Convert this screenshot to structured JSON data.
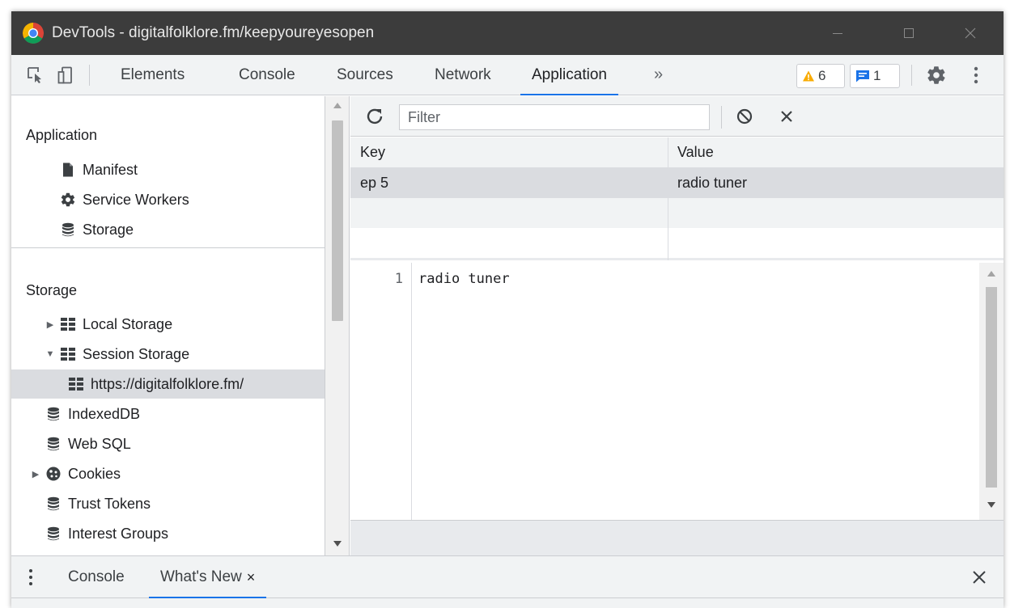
{
  "window": {
    "title": "DevTools - digitalfolklore.fm/keepyoureyesopen"
  },
  "toolbar": {
    "tabs": [
      {
        "label": "Elements"
      },
      {
        "label": "Console"
      },
      {
        "label": "Sources"
      },
      {
        "label": "Network"
      },
      {
        "label": "Application"
      }
    ],
    "active_tab": "Application",
    "more": "»",
    "warnings_count": "6",
    "messages_count": "1"
  },
  "sidebar": {
    "application_heading": "Application",
    "application_items": [
      {
        "label": "Manifest",
        "icon": "document-icon"
      },
      {
        "label": "Service Workers",
        "icon": "gear-icon"
      },
      {
        "label": "Storage",
        "icon": "database-icon"
      }
    ],
    "storage_heading": "Storage",
    "storage_items": [
      {
        "label": "Local Storage",
        "icon": "grid-icon",
        "expander": "collapsed"
      },
      {
        "label": "Session Storage",
        "icon": "grid-icon",
        "expander": "expanded"
      },
      {
        "label": "https://digitalfolklore.fm/",
        "icon": "grid-icon",
        "selected": true
      },
      {
        "label": "IndexedDB",
        "icon": "database-icon"
      },
      {
        "label": "Web SQL",
        "icon": "database-icon"
      },
      {
        "label": "Cookies",
        "icon": "cookie-icon",
        "expander": "collapsed"
      },
      {
        "label": "Trust Tokens",
        "icon": "database-icon"
      },
      {
        "label": "Interest Groups",
        "icon": "database-icon"
      }
    ]
  },
  "filter": {
    "placeholder": "Filter"
  },
  "table": {
    "columns": [
      "Key",
      "Value"
    ],
    "rows": [
      {
        "key": "ep 5",
        "value": "radio tuner"
      }
    ]
  },
  "editor": {
    "line_number": "1",
    "line_text": "radio tuner"
  },
  "drawer": {
    "tabs": [
      {
        "label": "Console"
      },
      {
        "label": "What's New",
        "closable": "×"
      }
    ],
    "active_tab": "What's New"
  },
  "colors": {
    "accent": "#1a73e8",
    "titlebar": "#3c3c3c",
    "selection": "#dadce0",
    "warning": "#f9ab00"
  }
}
